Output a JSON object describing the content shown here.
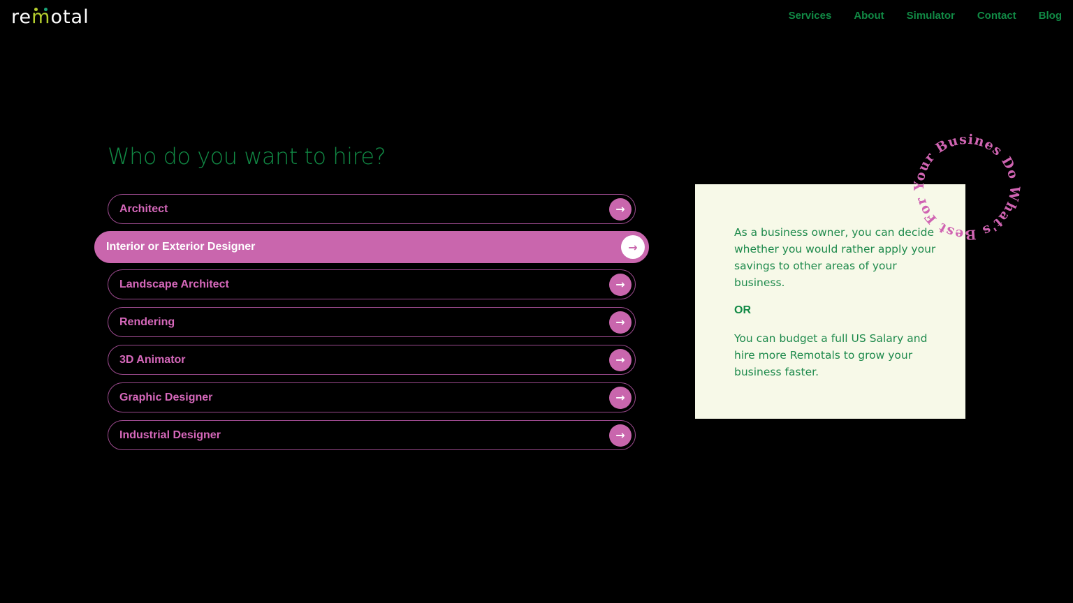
{
  "header": {
    "logo": {
      "prefix": "re",
      "m": "m",
      "suffix": "otal"
    },
    "nav": [
      {
        "label": "Services"
      },
      {
        "label": "About"
      },
      {
        "label": "Simulator"
      },
      {
        "label": "Contact"
      },
      {
        "label": "Blog"
      }
    ]
  },
  "main": {
    "heading": "Who do you want to hire?",
    "options": [
      {
        "label": "Architect",
        "active": false,
        "icon": "arrow-right-icon",
        "glyph": "→"
      },
      {
        "label": "Interior or Exterior Designer",
        "active": true,
        "icon": "arrow-right-icon",
        "glyph": "→"
      },
      {
        "label": "Landscape Architect",
        "active": false,
        "icon": "arrow-right-icon",
        "glyph": "→"
      },
      {
        "label": "Rendering",
        "active": false,
        "icon": "arrow-right-icon",
        "glyph": "→"
      },
      {
        "label": "3D Animator",
        "active": false,
        "icon": "arrow-right-icon",
        "glyph": "→"
      },
      {
        "label": "Graphic Designer",
        "active": false,
        "icon": "arrow-right-icon",
        "glyph": "→"
      },
      {
        "label": "Industrial Designer",
        "active": false,
        "icon": "arrow-right-icon",
        "glyph": "→"
      }
    ]
  },
  "card": {
    "paragraph1": "As a business owner, you can decide whether you would rather apply your savings to other areas of your business.",
    "or": "OR",
    "paragraph2": "You can budget a full US Salary and hire more Remotals to grow your business faster."
  },
  "badge": {
    "circular_text": "Do What's Best For Your Busines • "
  },
  "colors": {
    "background": "#000000",
    "brand_green": "#118a45",
    "accent_pink": "#c966ad",
    "card_bg": "#f7f9e8"
  }
}
